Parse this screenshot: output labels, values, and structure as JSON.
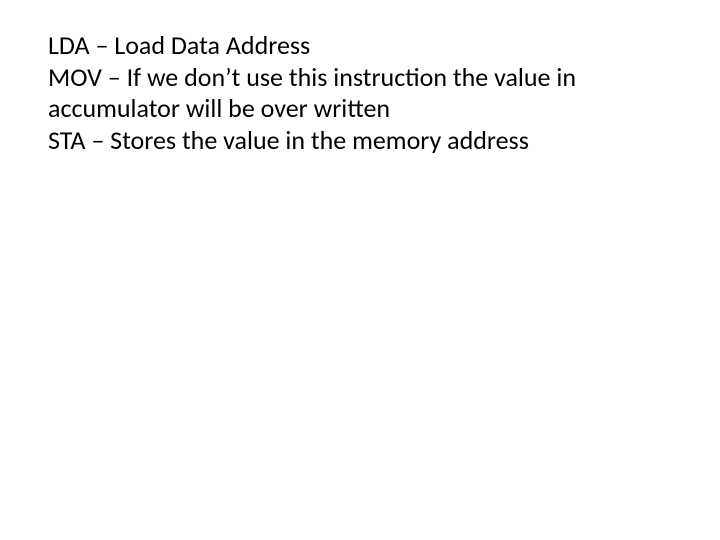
{
  "lines": [
    "LDA – Load Data Address",
    "MOV – If we don’t use this instruction the value in accumulator will be over written",
    "STA – Stores the value in the memory address"
  ]
}
